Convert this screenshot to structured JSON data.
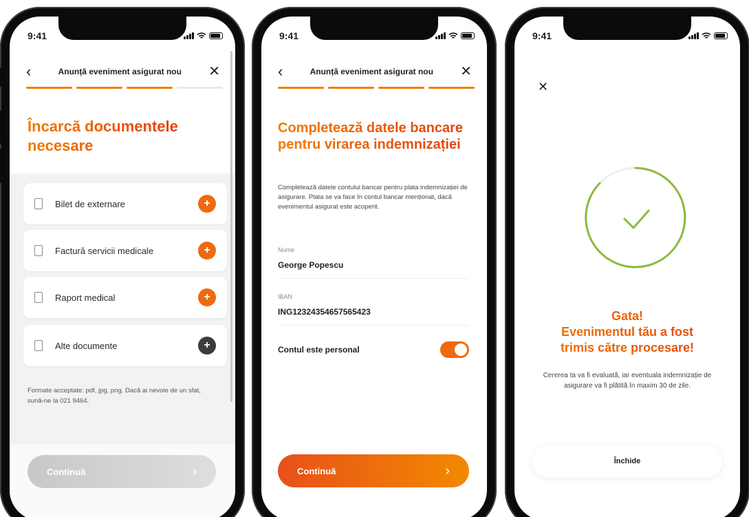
{
  "status_time": "9:41",
  "colors": {
    "accent": "#f07d00",
    "accent_dark": "#e3400e",
    "success": "#8cba3c"
  },
  "screen1": {
    "nav_title": "Anunță eveniment asigurat nou",
    "heading_line1": "Încarcă documentele",
    "heading_line2": "necesare",
    "documents": [
      {
        "label": "Bilet de externare",
        "action_icon": "plus-icon"
      },
      {
        "label": "Factură servicii medicale",
        "action_icon": "plus-icon"
      },
      {
        "label": "Raport medical",
        "action_icon": "plus-icon"
      },
      {
        "label": "Alte documente",
        "action_icon": "plus-icon"
      }
    ],
    "plus_symbol": "+",
    "note": "Formate acceptate: pdf, jpg, png. Dacă ai nevoie de un sfat, sună-ne la 021 9464.",
    "continue_label": "Continuă",
    "continue_enabled": false
  },
  "screen2": {
    "nav_title": "Anunță eveniment asigurat nou",
    "heading": "Completează datele bancare pentru virarea indemnizației",
    "description": "Completează datele contului bancar pentru plata indemnizației de asigurare. Plata se va face în contul bancar menționat, dacă evenimentul asigurat este acoperit.",
    "name_label": "Nume",
    "name_value": "George Popescu",
    "iban_label": "IBAN",
    "iban_value": "ING12324354657565423",
    "toggle_label": "Contul este personal",
    "toggle_on": true,
    "continue_label": "Continuă",
    "continue_enabled": true
  },
  "screen3": {
    "title_line1": "Gata!",
    "title_line2": "Evenimentul tău a fost",
    "title_line3": "trimis către procesare!",
    "text": "Cererea ta va fi evaluată, iar eventuala indemnizație de asigurare va fi plătită în maxim 30 de zile.",
    "close_label": "Închide"
  }
}
